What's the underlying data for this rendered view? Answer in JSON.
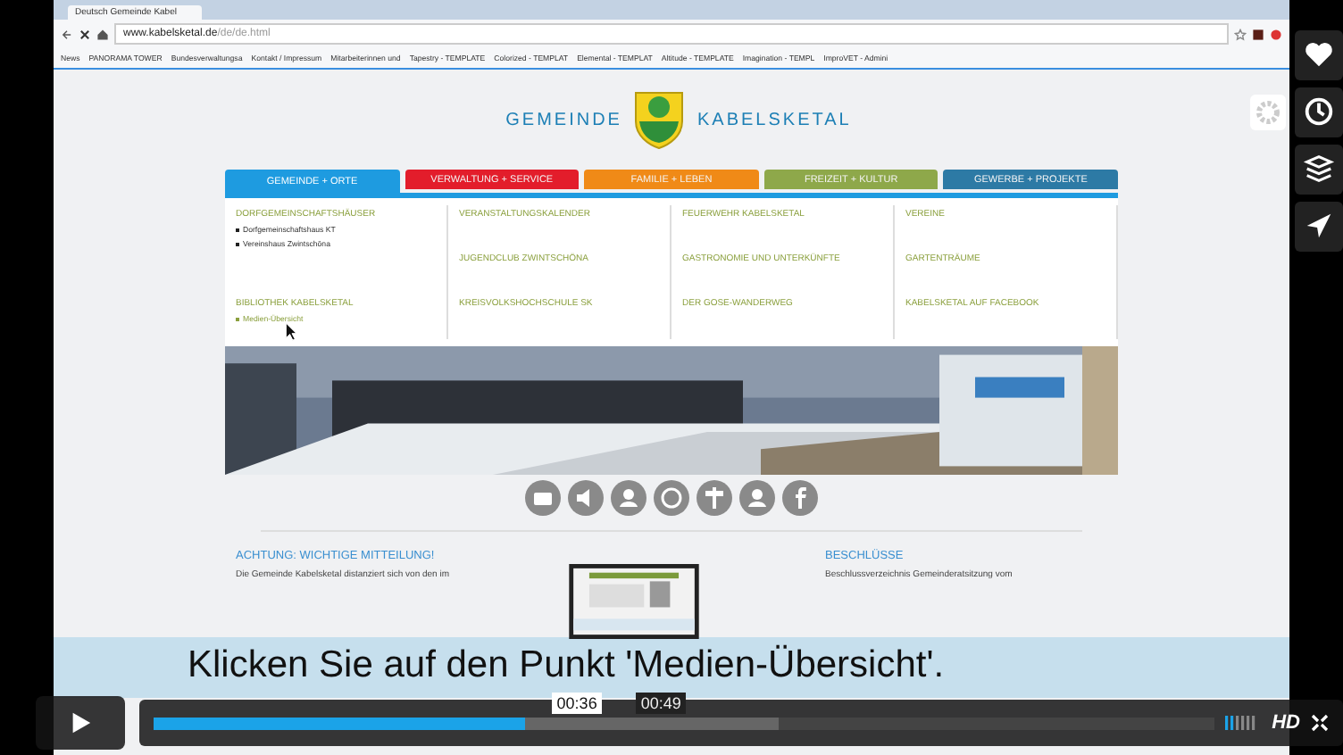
{
  "browser": {
    "tab_title": "Deutsch Gemeinde Kabel",
    "url_host": "www.kabelsketal.de",
    "url_path": "/de/de.html",
    "bookmarks": [
      "News",
      "PANORAMA TOWER",
      "Bundesverwaltungsa",
      "Kontakt / Impressum",
      "Mitarbeiterinnen und",
      "Tapestry - TEMPLATE",
      "Colorized - TEMPLAT",
      "Elemental - TEMPLAT",
      "Altitude - TEMPLATE",
      "Imagination - TEMPL",
      "ImproVET - Admini"
    ]
  },
  "site": {
    "title_left": "GEMEINDE",
    "title_right": "KABELSKETAL",
    "nav": [
      {
        "label": "GEMEINDE + ORTE",
        "color": "#1e9be0",
        "selected": true
      },
      {
        "label": "VERWALTUNG + SERVICE",
        "color": "#e31d2b",
        "selected": false
      },
      {
        "label": "FAMILIE + LEBEN",
        "color": "#f08a17",
        "selected": false
      },
      {
        "label": "FREIZEIT + KULTUR",
        "color": "#8ea84a",
        "selected": false
      },
      {
        "label": "GEWERBE + PROJEKTE",
        "color": "#2d7aa5",
        "selected": false
      }
    ],
    "menu": [
      [
        {
          "title": "DORFGEMEINSCHAFTSHÄUSER",
          "items": [
            {
              "label": "Dorfgemeinschaftshaus KT",
              "hovered": false
            },
            {
              "label": "Vereinshaus Zwintschöna",
              "hovered": false
            }
          ]
        },
        {
          "title": "BIBLIOTHEK KABELSKETAL",
          "items": [
            {
              "label": "Medien-Übersicht",
              "hovered": true
            }
          ]
        }
      ],
      [
        {
          "title": "VERANSTALTUNGSKALENDER"
        },
        {
          "title": "JUGENDCLUB ZWINTSCHÖNA"
        },
        {
          "title": "KREISVOLKSHOCHSCHULE SK"
        }
      ],
      [
        {
          "title": "FEUERWEHR KABELSKETAL"
        },
        {
          "title": "GASTRONOMIE UND UNTERKÜNFTE"
        },
        {
          "title": "DER GOSE-WANDERWEG"
        }
      ],
      [
        {
          "title": "VEREINE"
        },
        {
          "title": "GARTENTRÄUME"
        },
        {
          "title": "KABELSKETAL AUF FACEBOOK"
        }
      ]
    ],
    "columns": [
      {
        "heading": "ACHTUNG: WICHTIGE MITTEILUNG!",
        "text": "Die Gemeinde Kabelsketal distanziert sich von den im"
      },
      {
        "heading": "BESCHLÜSSE",
        "text": "Beschlussverzeichnis Gemeinderatsitzung vom"
      }
    ]
  },
  "player": {
    "subtitle": "Klicken Sie auf den Punkt 'Medien-Übersicht'.",
    "time": "00:36",
    "hover_time": "00:49",
    "level": 0.35,
    "quality": "HD"
  }
}
